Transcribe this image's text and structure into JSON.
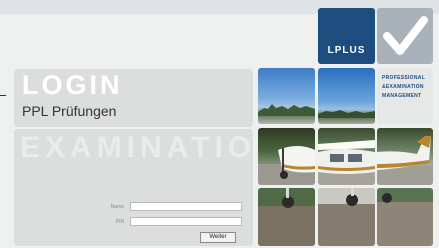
{
  "brand": {
    "logo_text": "LPLUS",
    "tagline": [
      "PROFESSIONAL",
      "&EXAMINATION",
      "MANAGEMENT"
    ]
  },
  "login": {
    "heading": "LOGIN",
    "subtitle": "PPL Prüfungen"
  },
  "exam": {
    "heading": "EXAMINATION"
  },
  "form": {
    "name_label": "Name",
    "name_value": "",
    "pin_label": "PIN",
    "pin_value": "",
    "submit_label": "Weiter"
  },
  "colors": {
    "brand_blue": "#1d4d7e",
    "panel_gray": "#dcdede",
    "page_bg": "#eef0f0"
  },
  "icons": [
    "checkmark-icon"
  ]
}
